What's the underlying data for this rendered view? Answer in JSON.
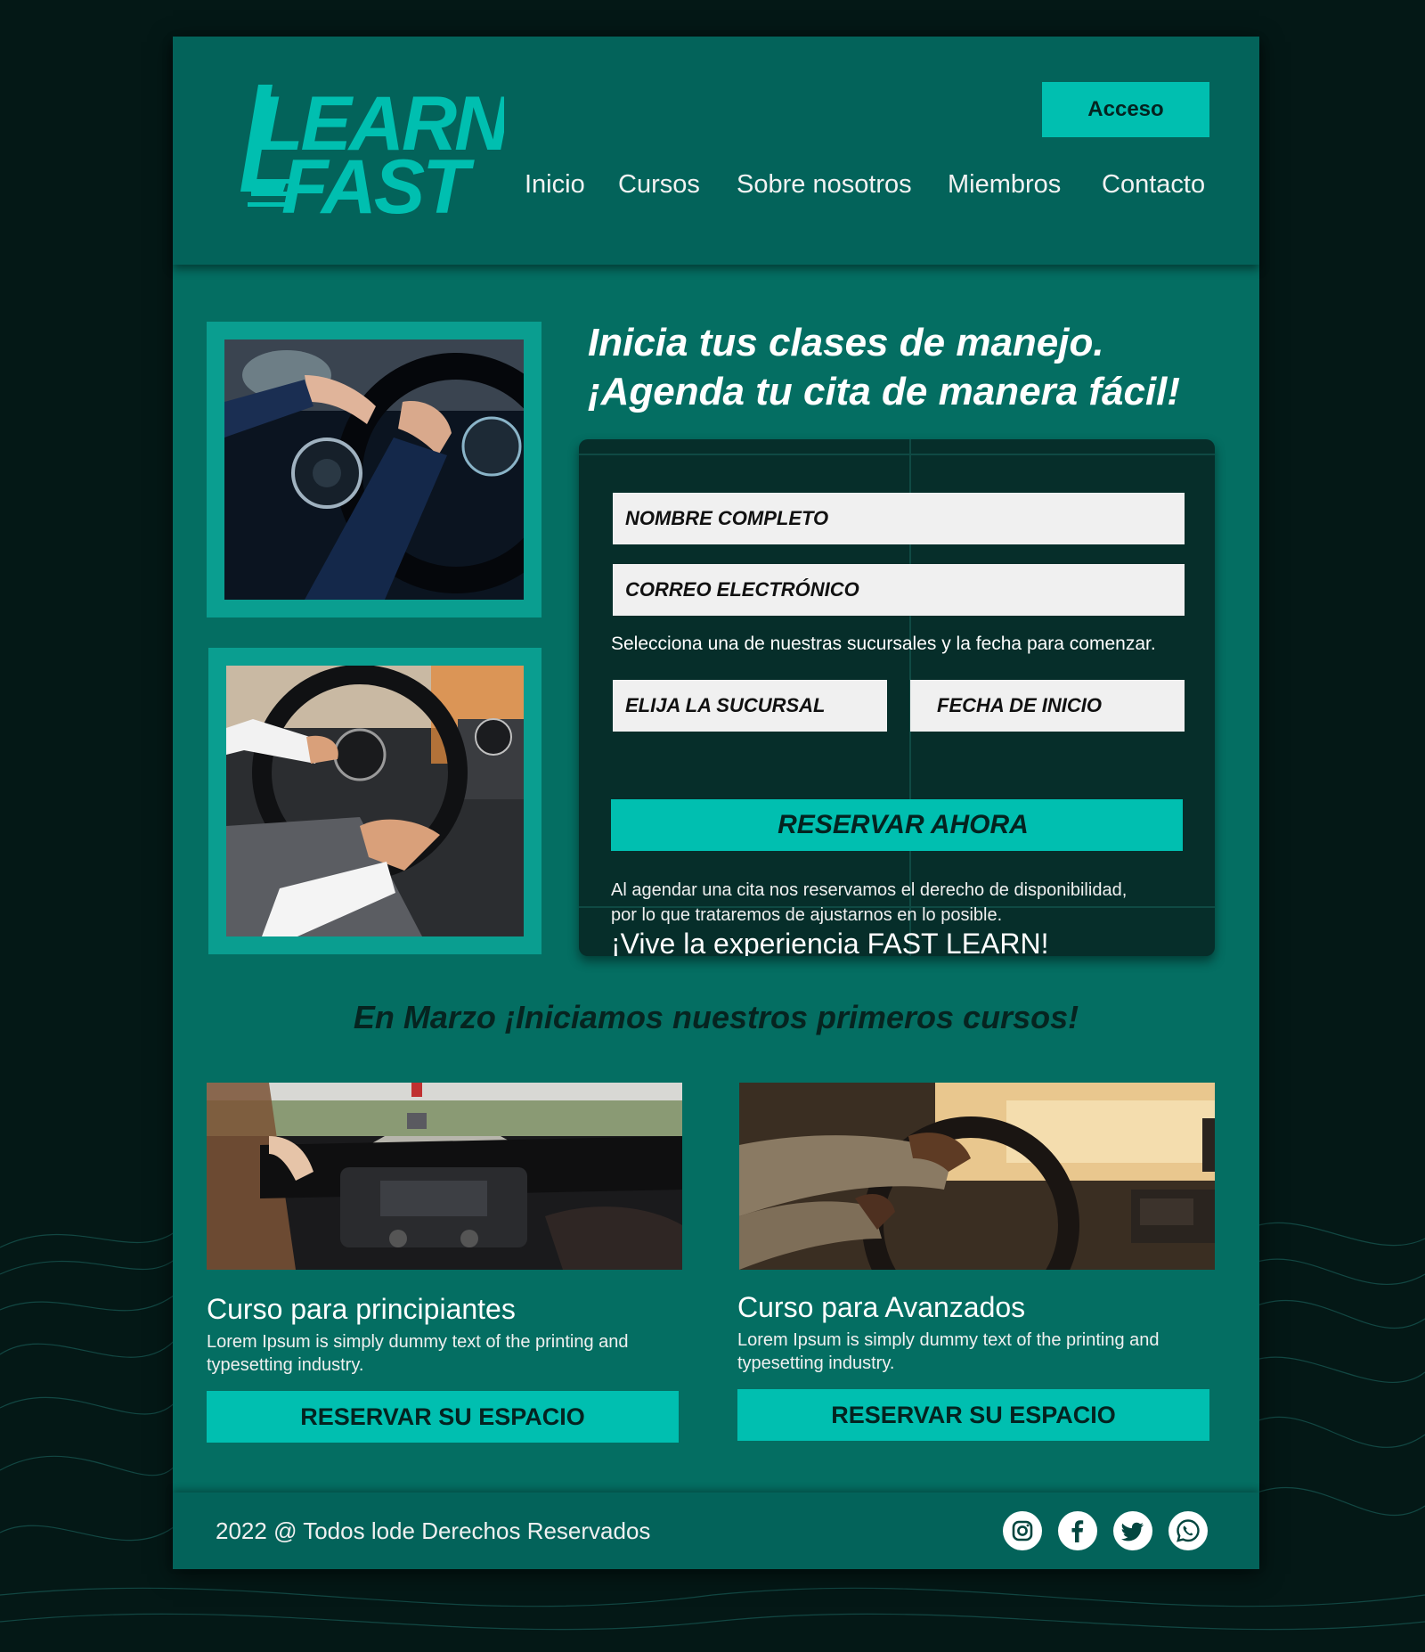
{
  "brand": {
    "logo_line1": "LEARN",
    "logo_line2": "FAST",
    "accent_color": "#00bfb0",
    "page_color": "#046e62",
    "header_color": "#03635a",
    "background_color": "#041816"
  },
  "header": {
    "login_label": "Acceso",
    "nav": [
      "Inicio",
      "Cursos",
      "Sobre nosotros",
      "Miembros",
      "Contacto"
    ]
  },
  "hero": {
    "title_line1": "Inicia tus clases de manejo.",
    "title_line2": "¡Agenda tu cita de manera fácil!",
    "photo1": "hands-on-steering-wheel-photo",
    "photo2": "driver-holding-wheel-photo"
  },
  "form": {
    "name_placeholder": "NOMBRE COMPLETO",
    "email_placeholder": "CORREO ELECTRÓNICO",
    "hint": "Selecciona una de nuestras sucursales y la fecha para comenzar.",
    "branch_label": "ELIJA LA SUCURSAL",
    "date_label": "FECHA DE INICIO",
    "submit_label": "RESERVAR AHORA",
    "disclaimer_line1": "Al agendar una cita nos reservamos el derecho  de disponibilidad,",
    "disclaimer_line2": "por lo que trataremos de ajustarnos en lo posible.",
    "slogan": "¡Vive la experiencia FAST LEARN!"
  },
  "courses": {
    "heading": "En Marzo ¡Iniciamos nuestros primeros cursos!",
    "items": [
      {
        "image": "highway-driving-photo",
        "title": "Curso para principiantes",
        "desc_line1": "Lorem Ipsum is simply dummy text of the printing and",
        "desc_line2": "typesetting industry.",
        "button": "RESERVAR SU ESPACIO"
      },
      {
        "image": "driver-in-car-photo",
        "title": "Curso para Avanzados",
        "desc_line1": "Lorem Ipsum is simply dummy text of the printing and",
        "desc_line2": "typesetting industry.",
        "button": "RESERVAR SU ESPACIO"
      }
    ]
  },
  "footer": {
    "copyright": "2022 @ Todos lode Derechos Reservados",
    "social_icons": [
      "instagram-icon",
      "facebook-icon",
      "twitter-icon",
      "whatsapp-icon"
    ]
  }
}
